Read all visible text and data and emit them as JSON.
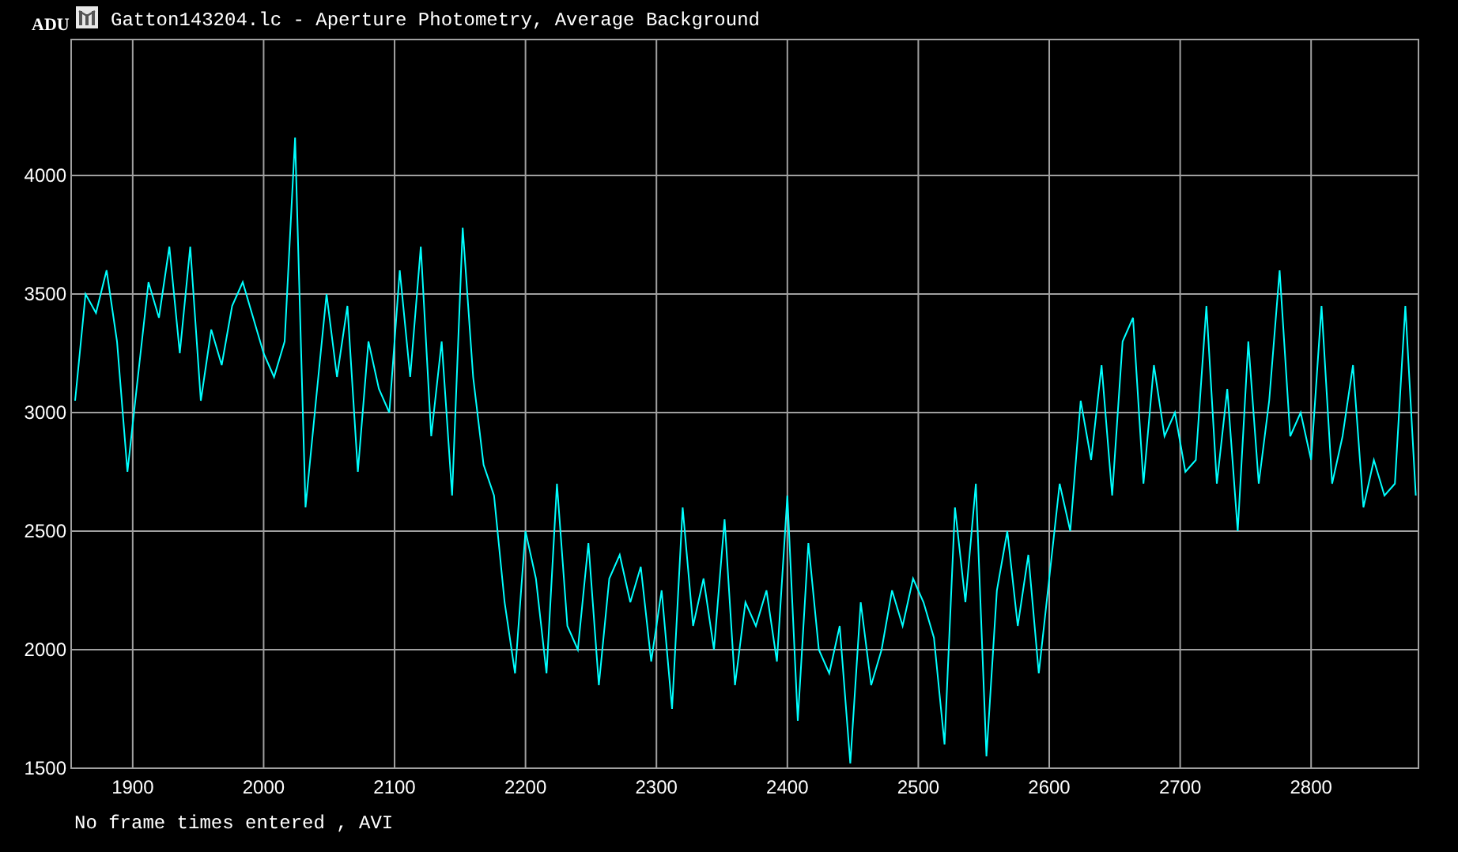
{
  "window": {
    "title": "Gatton143204.lc - Aperture Photometry, Average Background"
  },
  "chart_data": {
    "type": "line",
    "ylabel": "ADU",
    "xlim": [
      1853,
      2882
    ],
    "grid": true,
    "ylim": [
      1500,
      4573
    ],
    "xticks": [
      1900,
      2000,
      2100,
      2200,
      2300,
      2400,
      2500,
      2600,
      2700,
      2800
    ],
    "yticks": [
      1500,
      2000,
      2500,
      3000,
      3500,
      4000
    ],
    "x": [
      1856,
      1864,
      1872,
      1880,
      1888,
      1896,
      1904,
      1912,
      1920,
      1928,
      1936,
      1944,
      1952,
      1960,
      1968,
      1976,
      1984,
      1992,
      2000,
      2008,
      2016,
      2024,
      2032,
      2040,
      2048,
      2056,
      2064,
      2072,
      2080,
      2088,
      2096,
      2104,
      2112,
      2120,
      2128,
      2136,
      2144,
      2152,
      2160,
      2168,
      2176,
      2184,
      2192,
      2200,
      2208,
      2216,
      2224,
      2232,
      2240,
      2248,
      2256,
      2264,
      2272,
      2280,
      2288,
      2296,
      2304,
      2312,
      2320,
      2328,
      2336,
      2344,
      2352,
      2360,
      2368,
      2376,
      2384,
      2392,
      2400,
      2408,
      2416,
      2424,
      2432,
      2440,
      2448,
      2456,
      2464,
      2472,
      2480,
      2488,
      2496,
      2504,
      2512,
      2520,
      2528,
      2536,
      2544,
      2552,
      2560,
      2568,
      2576,
      2584,
      2592,
      2600,
      2608,
      2616,
      2624,
      2632,
      2640,
      2648,
      2656,
      2664,
      2672,
      2680,
      2688,
      2696,
      2704,
      2712,
      2720,
      2728,
      2736,
      2744,
      2752,
      2760,
      2768,
      2776,
      2784,
      2792,
      2800,
      2808,
      2816,
      2824,
      2832,
      2840,
      2848,
      2856,
      2864,
      2872,
      2880
    ],
    "series": [
      {
        "color": "#00ffff",
        "values": [
          3050,
          3500,
          3420,
          3600,
          3300,
          2750,
          3150,
          3550,
          3400,
          3700,
          3250,
          3700,
          3050,
          3350,
          3200,
          3450,
          3550,
          3400,
          3250,
          3150,
          3300,
          4160,
          2600,
          3050,
          3500,
          3150,
          3450,
          2750,
          3300,
          3100,
          3000,
          3600,
          3150,
          3700,
          2900,
          3300,
          2650,
          3780,
          3150,
          2780,
          2650,
          2200,
          1900,
          2500,
          2300,
          1900,
          2700,
          2100,
          2000,
          2450,
          1850,
          2300,
          2400,
          2200,
          2350,
          1950,
          2250,
          1750,
          2600,
          2100,
          2300,
          2000,
          2550,
          1850,
          2200,
          2100,
          2250,
          1950,
          2650,
          1700,
          2450,
          2000,
          1900,
          2100,
          1520,
          2200,
          1850,
          2000,
          2250,
          2100,
          2300,
          2200,
          2050,
          1600,
          2600,
          2200,
          2700,
          1550,
          2250,
          2500,
          2100,
          2400,
          1900,
          2300,
          2700,
          2500,
          3050,
          2800,
          3200,
          2650,
          3300,
          3400,
          2700,
          3200,
          2900,
          3000,
          2750,
          2800,
          3450,
          2700,
          3100,
          2500,
          3300,
          2700,
          3050,
          3600,
          2900,
          3000,
          2800,
          3450,
          2700,
          2900,
          3200,
          2600,
          2800,
          2650,
          2700,
          3450,
          2650
        ]
      }
    ]
  },
  "status_text": "No frame times entered , AVI"
}
